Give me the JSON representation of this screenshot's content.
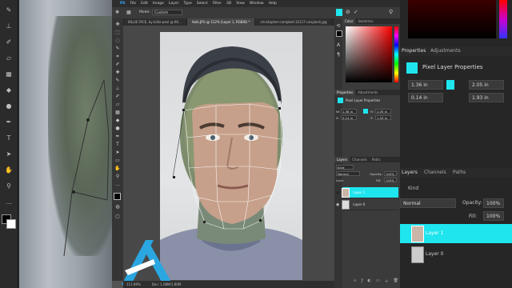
{
  "app": {
    "menu": [
      "PS",
      "File",
      "Edit",
      "Image",
      "Layer",
      "Type",
      "Select",
      "Filter",
      "3D",
      "View",
      "Window",
      "Help"
    ],
    "options_mode_label": "Mode:",
    "options_mode_value": "Custom"
  },
  "document_tabs": [
    {
      "label": "BILLIE FACE, by billie-pexl @ 66..."
    },
    {
      "label": "Hulk.JPG @ 112% (Layer 1, RGB/8) *"
    },
    {
      "label": "christopher-campbell-32117-unsplash.jpg"
    }
  ],
  "status": {
    "zoom": "111.89%",
    "doc": "Doc: 1.08M/1.80M"
  },
  "color_panel": {
    "tabs": [
      "Color",
      "Swatches"
    ],
    "accent": "#1ee5ee"
  },
  "properties_panel": {
    "tabs": [
      "Properties",
      "Adjustments"
    ],
    "title": "Pixel Layer Properties",
    "w_label": "W:",
    "w_value": "1.36 in",
    "h_label": "H:",
    "h_value": "2.05 in",
    "x_label": "X:",
    "x_value": "0.14 in",
    "y_label": "Y:",
    "y_value": "1.93 in"
  },
  "layers_panel": {
    "tabs": [
      "Layers",
      "Channels",
      "Paths"
    ],
    "kind_label": "Kind",
    "blend_mode": "Normal",
    "opacity_label": "Opacity:",
    "opacity_value": "100%",
    "lock_label": "Lock:",
    "fill_label": "Fill:",
    "fill_value": "100%",
    "layers": [
      {
        "name": "Layer 1",
        "selected": true
      },
      {
        "name": "Layer 0",
        "selected": false
      }
    ]
  },
  "bg_right": {
    "title": "Pixel Layer Properties",
    "tabs": [
      "Properties",
      "Adjustments"
    ],
    "w_value": "1.36 in",
    "h_value": "2.05 in",
    "x_value": "0.14 in",
    "y_value": "1.93 in",
    "layer_tabs": [
      "Layers",
      "Channels",
      "Paths"
    ],
    "kind_label": "Kind",
    "blend_mode": "Normal",
    "opacity_label": "Opacity:",
    "opacity_value": "100%",
    "fill_label": "Fill:",
    "fill_value": "100%",
    "layer1": "Layer 1",
    "layer0": "Layer 0"
  }
}
